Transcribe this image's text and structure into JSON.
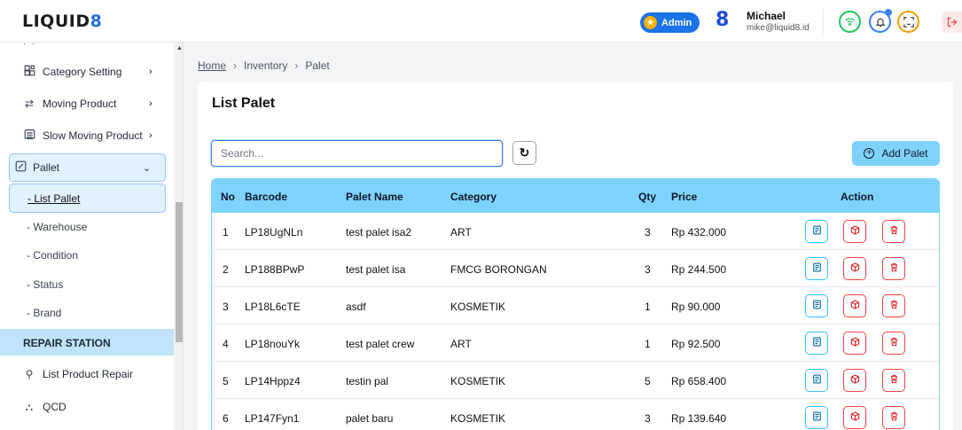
{
  "header": {
    "logo_main": "LIQUID",
    "logo_accent": "8",
    "role_badge": "Admin",
    "user_logo": "8",
    "user_name": "Michael",
    "user_email": "mike@liquid8.id",
    "icons": [
      "wifi-icon",
      "bell-icon",
      "scan-face-icon",
      "logout-icon"
    ]
  },
  "sidebar": {
    "items": [
      {
        "label": "Category Setting",
        "icon": "category-grid-icon"
      },
      {
        "label": "Moving Product",
        "icon": "moving-arrows-icon"
      },
      {
        "label": "Slow Moving Product",
        "icon": "box-icon"
      },
      {
        "label": "Pallet",
        "icon": "pallet-icon"
      }
    ],
    "pallet_sub": [
      "- List Pallet",
      "- Warehouse",
      "- Condition",
      "- Status",
      "- Brand"
    ],
    "section": "REPAIR STATION",
    "repair_items": [
      {
        "label": "List Product Repair",
        "icon": "repair-icon"
      },
      {
        "label": "QCD",
        "icon": "qcd-icon"
      }
    ]
  },
  "breadcrumb": {
    "home": "Home",
    "level1": "Inventory",
    "level2": "Palet"
  },
  "main": {
    "title": "List Palet",
    "search_placeholder": "Search...",
    "add_label": "Add Palet"
  },
  "table": {
    "headers": [
      "No",
      "Barcode",
      "Palet Name",
      "Category",
      "Qty",
      "Price",
      "Action"
    ],
    "rows": [
      {
        "no": "1",
        "barcode": "LP18UgNLn",
        "name": "test palet isa2",
        "category": "ART",
        "qty": "3",
        "price": "Rp 432.000"
      },
      {
        "no": "2",
        "barcode": "LP188BPwP",
        "name": "test palet isa",
        "category": "FMCG BORONGAN",
        "qty": "3",
        "price": "Rp 244.500"
      },
      {
        "no": "3",
        "barcode": "LP18L6cTE",
        "name": "asdf",
        "category": "KOSMETIK",
        "qty": "1",
        "price": "Rp 90.000"
      },
      {
        "no": "4",
        "barcode": "LP18nouYk",
        "name": "test palet crew",
        "category": "ART",
        "qty": "1",
        "price": "Rp 92.500"
      },
      {
        "no": "5",
        "barcode": "LP14Hppz4",
        "name": "testin pal",
        "category": "KOSMETIK",
        "qty": "5",
        "price": "Rp 658.400"
      },
      {
        "no": "6",
        "barcode": "LP147Fyn1",
        "name": "palet baru",
        "category": "KOSMETIK",
        "qty": "3",
        "price": "Rp 139.640"
      }
    ]
  },
  "colors": {
    "accent": "#7dd3fc",
    "primary": "#1a73e8",
    "danger": "#ef4444"
  }
}
